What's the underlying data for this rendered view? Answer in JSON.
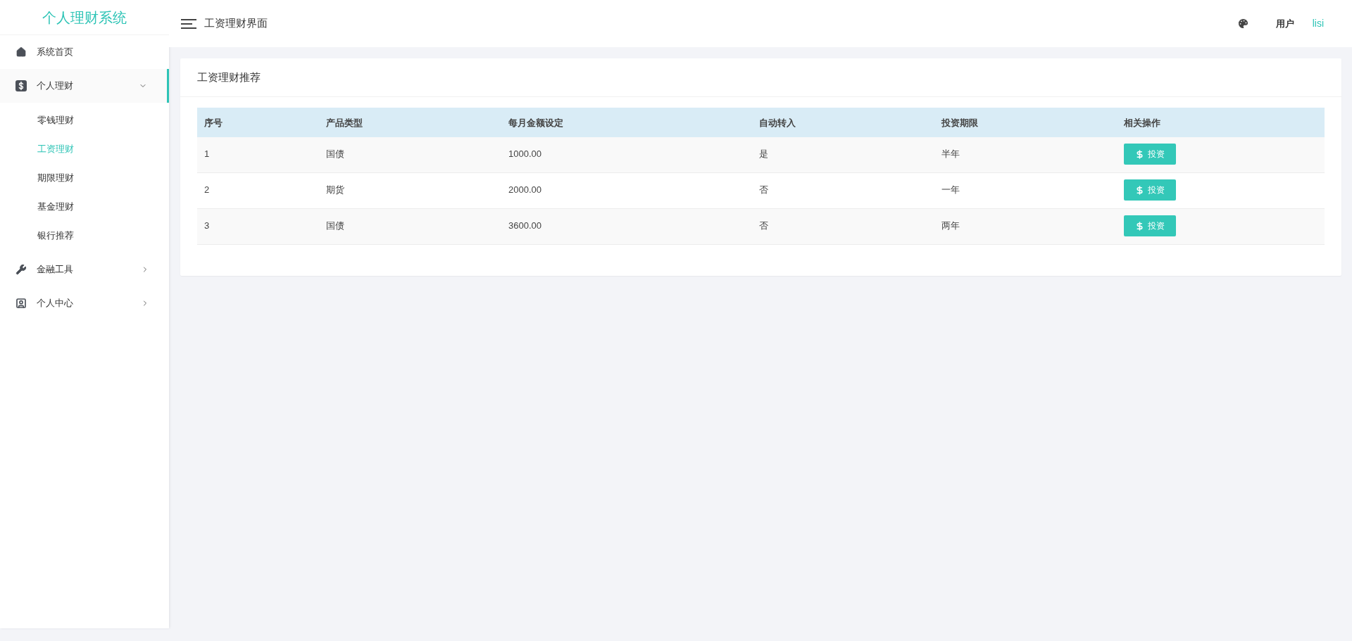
{
  "app_title": "个人理财系统",
  "sidebar": {
    "items": [
      {
        "label": "系统首页",
        "selected": false
      },
      {
        "label": "个人理财",
        "selected": true,
        "expanded": true,
        "children": [
          {
            "label": "零钱理财",
            "selected": false
          },
          {
            "label": "工资理财",
            "selected": true
          },
          {
            "label": "期限理财",
            "selected": false
          },
          {
            "label": "基金理财",
            "selected": false
          },
          {
            "label": "银行推荐",
            "selected": false
          }
        ]
      },
      {
        "label": "金融工具",
        "selected": false,
        "expanded": false
      },
      {
        "label": "个人中心",
        "selected": false,
        "expanded": false
      }
    ]
  },
  "header": {
    "title": "工资理财界面",
    "user_label": "用户",
    "username": "lisi"
  },
  "card": {
    "title": "工资理财推荐",
    "table": {
      "columns": [
        "序号",
        "产品类型",
        "每月金额设定",
        "自动转入",
        "投资期限",
        "相关操作"
      ],
      "rows": [
        {
          "cells": [
            "1",
            "国债",
            "1000.00",
            "是",
            "半年"
          ],
          "action": "投资"
        },
        {
          "cells": [
            "2",
            "期货",
            "2000.00",
            "否",
            "一年"
          ],
          "action": "投资"
        },
        {
          "cells": [
            "3",
            "国债",
            "3600.00",
            "否",
            "两年"
          ],
          "action": "投资"
        }
      ]
    }
  }
}
